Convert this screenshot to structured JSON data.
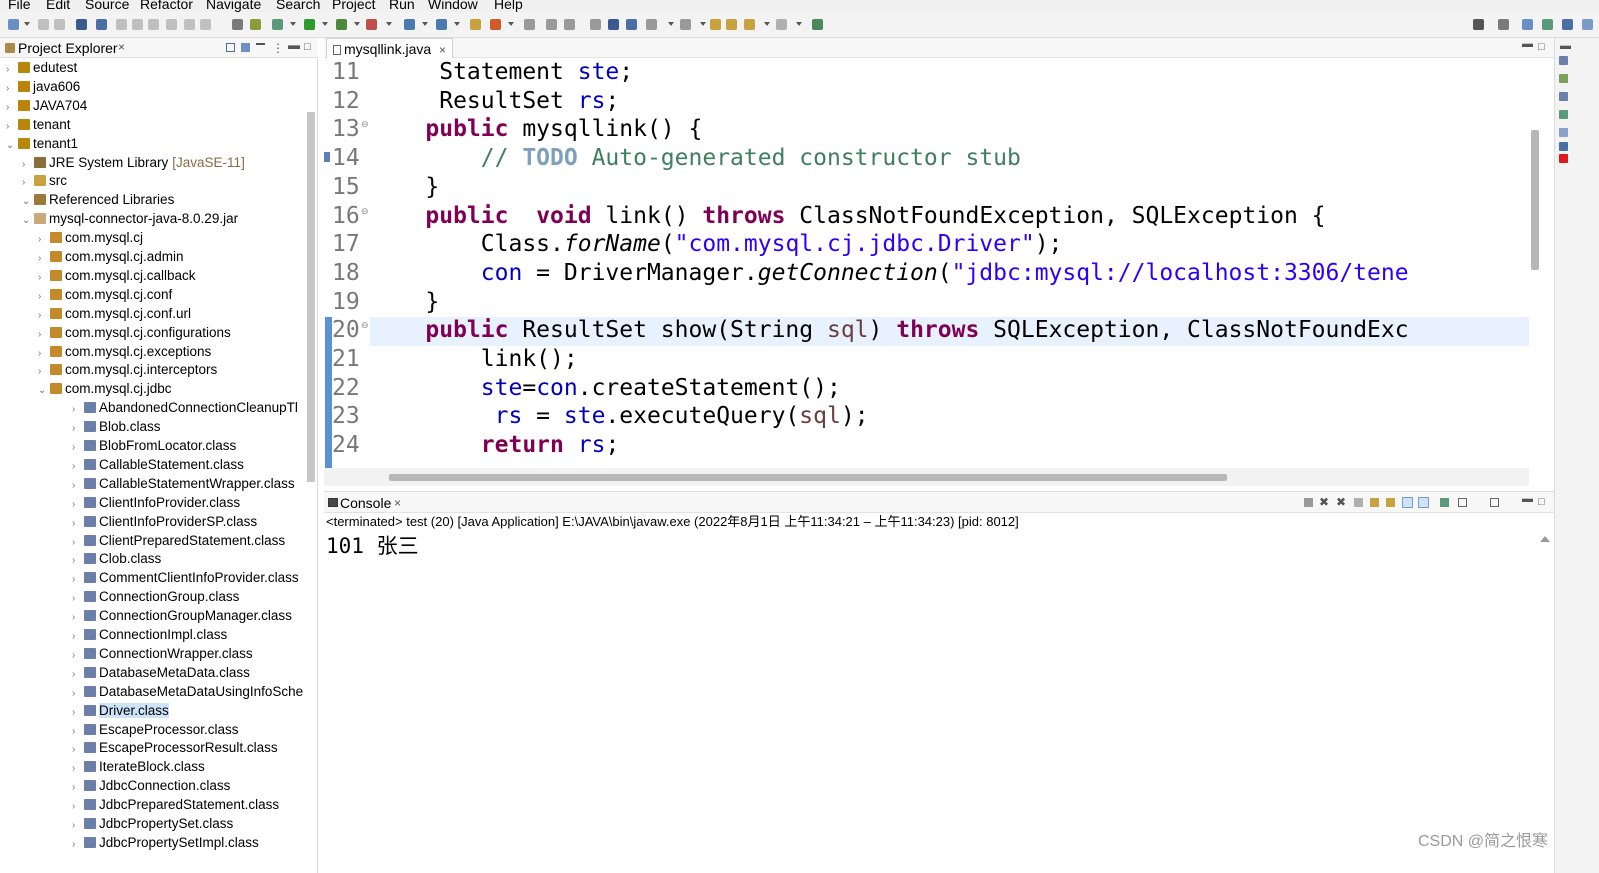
{
  "menu": [
    "File",
    "Edit",
    "Source",
    "Refactor",
    "Navigate",
    "Search",
    "Project",
    "Run",
    "Window",
    "Help"
  ],
  "explorer": {
    "title": "Project Explorer",
    "close": "×",
    "rows": [
      {
        "label": "edutest",
        "arrow": "›",
        "type": "proj",
        "indent": 0
      },
      {
        "label": "java606",
        "arrow": "›",
        "type": "proj",
        "indent": 0
      },
      {
        "label": "JAVA704",
        "arrow": "›",
        "type": "proj",
        "indent": 0
      },
      {
        "label": "tenant",
        "arrow": "›",
        "type": "proj",
        "indent": 0
      },
      {
        "label": "tenant1",
        "arrow": "⌄",
        "type": "proj",
        "indent": 0
      },
      {
        "label": "JRE System Library",
        "extra": "[JavaSE-11]",
        "arrow": "›",
        "type": "jre",
        "indent": 1
      },
      {
        "label": "src",
        "arrow": "›",
        "type": "src",
        "indent": 1
      },
      {
        "label": "Referenced Libraries",
        "arrow": "⌄",
        "type": "lib",
        "indent": 1
      },
      {
        "label": "mysql-connector-java-8.0.29.jar",
        "arrow": "⌄",
        "type": "jar",
        "indent": 2
      },
      {
        "label": "com.mysql.cj",
        "arrow": "›",
        "type": "pkg",
        "indent": 3
      },
      {
        "label": "com.mysql.cj.admin",
        "arrow": "›",
        "type": "pkg",
        "indent": 3
      },
      {
        "label": "com.mysql.cj.callback",
        "arrow": "›",
        "type": "pkg",
        "indent": 3
      },
      {
        "label": "com.mysql.cj.conf",
        "arrow": "›",
        "type": "pkg",
        "indent": 3
      },
      {
        "label": "com.mysql.cj.conf.url",
        "arrow": "›",
        "type": "pkg",
        "indent": 3
      },
      {
        "label": "com.mysql.cj.configurations",
        "arrow": "›",
        "type": "pkg",
        "indent": 3
      },
      {
        "label": "com.mysql.cj.exceptions",
        "arrow": "›",
        "type": "pkg",
        "indent": 3
      },
      {
        "label": "com.mysql.cj.interceptors",
        "arrow": "›",
        "type": "pkg",
        "indent": 3
      },
      {
        "label": "com.mysql.cj.jdbc",
        "arrow": "⌄",
        "type": "pkg",
        "indent": 3
      },
      {
        "label": "AbandonedConnectionCleanupTl",
        "arrow": "›",
        "type": "cls",
        "indent": 4
      },
      {
        "label": "Blob.class",
        "arrow": "›",
        "type": "cls",
        "indent": 4
      },
      {
        "label": "BlobFromLocator.class",
        "arrow": "›",
        "type": "cls",
        "indent": 4
      },
      {
        "label": "CallableStatement.class",
        "arrow": "›",
        "type": "cls",
        "indent": 4
      },
      {
        "label": "CallableStatementWrapper.class",
        "arrow": "›",
        "type": "cls",
        "indent": 4
      },
      {
        "label": "ClientInfoProvider.class",
        "arrow": "›",
        "type": "cls",
        "indent": 4
      },
      {
        "label": "ClientInfoProviderSP.class",
        "arrow": "›",
        "type": "cls",
        "indent": 4
      },
      {
        "label": "ClientPreparedStatement.class",
        "arrow": "›",
        "type": "cls",
        "indent": 4
      },
      {
        "label": "Clob.class",
        "arrow": "›",
        "type": "cls",
        "indent": 4
      },
      {
        "label": "CommentClientInfoProvider.class",
        "arrow": "›",
        "type": "cls",
        "indent": 4
      },
      {
        "label": "ConnectionGroup.class",
        "arrow": "›",
        "type": "cls",
        "indent": 4
      },
      {
        "label": "ConnectionGroupManager.class",
        "arrow": "›",
        "type": "cls",
        "indent": 4
      },
      {
        "label": "ConnectionImpl.class",
        "arrow": "›",
        "type": "cls",
        "indent": 4
      },
      {
        "label": "ConnectionWrapper.class",
        "arrow": "›",
        "type": "cls",
        "indent": 4
      },
      {
        "label": "DatabaseMetaData.class",
        "arrow": "›",
        "type": "cls",
        "indent": 4
      },
      {
        "label": "DatabaseMetaDataUsingInfoSche",
        "arrow": "›",
        "type": "cls",
        "indent": 4
      },
      {
        "label": "Driver.class",
        "arrow": "›",
        "type": "cls",
        "indent": 4,
        "selected": true
      },
      {
        "label": "EscapeProcessor.class",
        "arrow": "›",
        "type": "cls",
        "indent": 4
      },
      {
        "label": "EscapeProcessorResult.class",
        "arrow": "›",
        "type": "cls",
        "indent": 4
      },
      {
        "label": "IterateBlock.class",
        "arrow": "›",
        "type": "cls",
        "indent": 4
      },
      {
        "label": "JdbcConnection.class",
        "arrow": "›",
        "type": "cls",
        "indent": 4
      },
      {
        "label": "JdbcPreparedStatement.class",
        "arrow": "›",
        "type": "cls",
        "indent": 4
      },
      {
        "label": "JdbcPropertySet.class",
        "arrow": "›",
        "type": "cls",
        "indent": 4
      },
      {
        "label": "JdbcPropertySetImpl.class",
        "arrow": "›",
        "type": "cls",
        "indent": 4
      }
    ]
  },
  "editor": {
    "tab_label": "mysqllink.java",
    "tab_close": "×",
    "current_line": 20,
    "lines": [
      {
        "n": "11",
        "marker": "",
        "toks": [
          [
            "",
            "     Statement "
          ],
          [
            "fld",
            "ste"
          ],
          [
            "",
            ";"
          ]
        ]
      },
      {
        "n": "12",
        "marker": "",
        "toks": [
          [
            "",
            "     ResultSet "
          ],
          [
            "fld",
            "rs"
          ],
          [
            "",
            ";"
          ]
        ]
      },
      {
        "n": "13",
        "marker": "⊖",
        "toks": [
          [
            "",
            "    "
          ],
          [
            "kw",
            "public"
          ],
          [
            "",
            " mysqllink() {"
          ]
        ]
      },
      {
        "n": "14",
        "marker": "",
        "toks": [
          [
            "",
            "        "
          ],
          [
            "cm",
            "// "
          ],
          [
            "todo",
            "TODO"
          ],
          [
            "cm",
            " Auto-generated constructor stub"
          ]
        ]
      },
      {
        "n": "15",
        "marker": "",
        "toks": [
          [
            "",
            "    }"
          ]
        ]
      },
      {
        "n": "16",
        "marker": "⊖",
        "toks": [
          [
            "",
            "    "
          ],
          [
            "kw",
            "public"
          ],
          [
            "",
            "  "
          ],
          [
            "kw",
            "void"
          ],
          [
            "",
            " link() "
          ],
          [
            "kw",
            "throws"
          ],
          [
            "",
            " ClassNotFoundException, SQLException {"
          ]
        ]
      },
      {
        "n": "17",
        "marker": "",
        "toks": [
          [
            "",
            "        Class."
          ],
          [
            "it",
            "forName"
          ],
          [
            "",
            "("
          ],
          [
            "str",
            "\"com.mysql.cj.jdbc.Driver\""
          ],
          [
            "",
            ");"
          ]
        ]
      },
      {
        "n": "18",
        "marker": "",
        "toks": [
          [
            "",
            "        "
          ],
          [
            "fld",
            "con"
          ],
          [
            "",
            " = DriverManager."
          ],
          [
            "it",
            "getConnection"
          ],
          [
            "",
            "("
          ],
          [
            "str",
            "\"jdbc:mysql://localhost:3306/tene"
          ]
        ]
      },
      {
        "n": "19",
        "marker": "",
        "toks": [
          [
            "",
            "    }"
          ]
        ]
      },
      {
        "n": "20",
        "marker": "⊖",
        "toks": [
          [
            "",
            "    "
          ],
          [
            "kw",
            "public"
          ],
          [
            "",
            " ResultSet show(String "
          ],
          [
            "prm",
            "sql"
          ],
          [
            "",
            ") "
          ],
          [
            "kw",
            "throws"
          ],
          [
            "",
            " SQLException, ClassNotFoundExc"
          ]
        ]
      },
      {
        "n": "21",
        "marker": "",
        "toks": [
          [
            "",
            "        link();"
          ]
        ]
      },
      {
        "n": "22",
        "marker": "",
        "toks": [
          [
            "",
            "        "
          ],
          [
            "fld",
            "ste"
          ],
          [
            "",
            "="
          ],
          [
            "fld",
            "con"
          ],
          [
            "",
            ".createStatement();"
          ]
        ]
      },
      {
        "n": "23",
        "marker": "",
        "toks": [
          [
            "",
            "         "
          ],
          [
            "fld",
            "rs"
          ],
          [
            "",
            " = "
          ],
          [
            "fld",
            "ste"
          ],
          [
            "",
            ".executeQuery("
          ],
          [
            "prm",
            "sql"
          ],
          [
            "",
            ");"
          ]
        ]
      },
      {
        "n": "24",
        "marker": "",
        "toks": [
          [
            "",
            "        "
          ],
          [
            "kw",
            "return"
          ],
          [
            "",
            " "
          ],
          [
            "fld",
            "rs"
          ],
          [
            "",
            ";"
          ]
        ]
      }
    ]
  },
  "console": {
    "title": "Console",
    "close": "×",
    "status": "<terminated> test (20) [Java Application] E:\\JAVA\\bin\\javaw.exe  (2022年8月1日 上午11:34:21 – 上午11:34:23) [pid: 8012]",
    "output": "101 张三"
  },
  "watermark": "CSDN @简之恨寒",
  "colors": {
    "keyword": "#7f0055",
    "field": "#0000c0",
    "string": "#2a00ff",
    "comment": "#3f7f5f",
    "selection": "#cde3f8",
    "current_line": "#e8f2fe"
  }
}
